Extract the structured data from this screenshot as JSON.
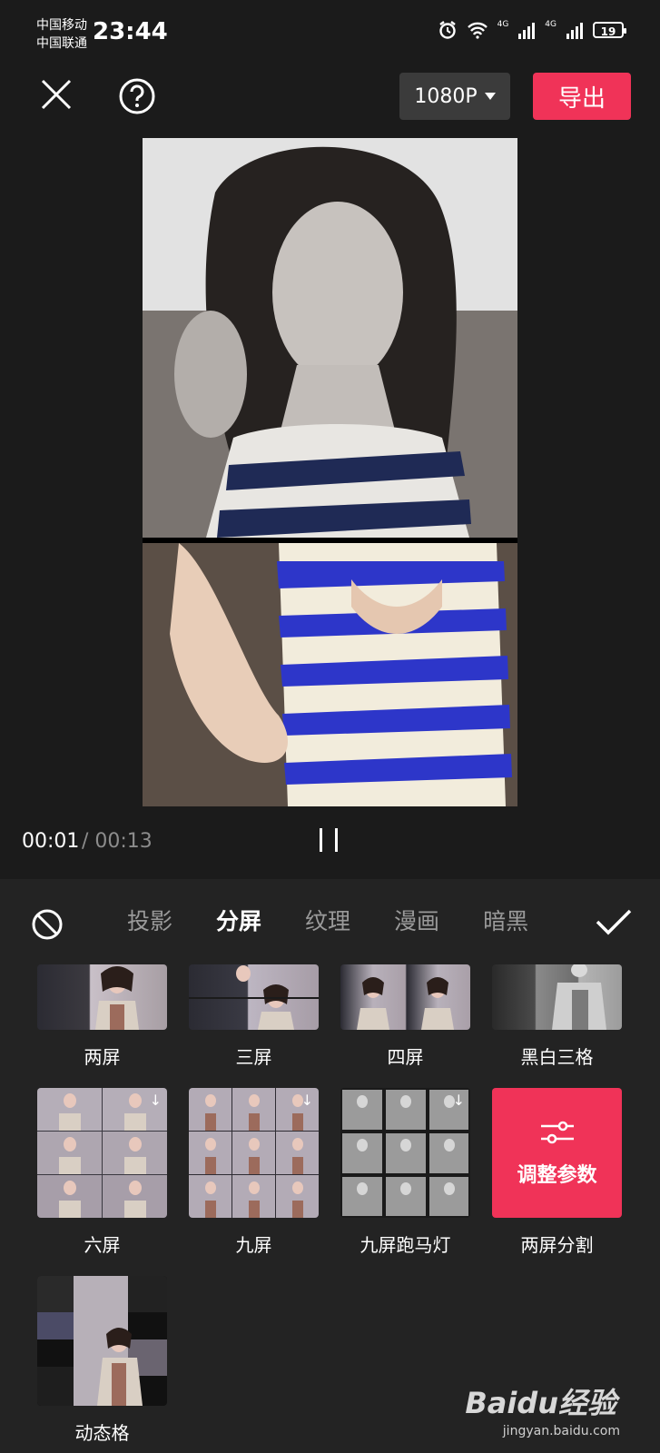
{
  "status_bar": {
    "carrier1": "中国移动",
    "carrier2": "中国联通",
    "time": "23:44",
    "battery": "19",
    "net1": "4G",
    "net2": "4G"
  },
  "toolbar": {
    "resolution": "1080P",
    "export_label": "导出"
  },
  "player": {
    "current_time": "00:01",
    "total_time": "/ 00:13"
  },
  "effects_panel": {
    "tabs": [
      {
        "label": "投影"
      },
      {
        "label": "分屏"
      },
      {
        "label": "纹理"
      },
      {
        "label": "漫画"
      },
      {
        "label": "暗黑"
      }
    ],
    "items": [
      {
        "label": "两屏"
      },
      {
        "label": "三屏"
      },
      {
        "label": "四屏"
      },
      {
        "label": "黑白三格"
      },
      {
        "label": "六屏"
      },
      {
        "label": "九屏"
      },
      {
        "label": "九屏跑马灯"
      },
      {
        "label": "两屏分割",
        "overlay_label": "调整参数"
      },
      {
        "label": "动态格"
      }
    ]
  },
  "watermark": {
    "brand": "Baidu经验",
    "url": "jingyan.baidu.com"
  },
  "colors": {
    "accent": "#f03358",
    "background": "#1b1b1b",
    "panel": "#232323"
  }
}
